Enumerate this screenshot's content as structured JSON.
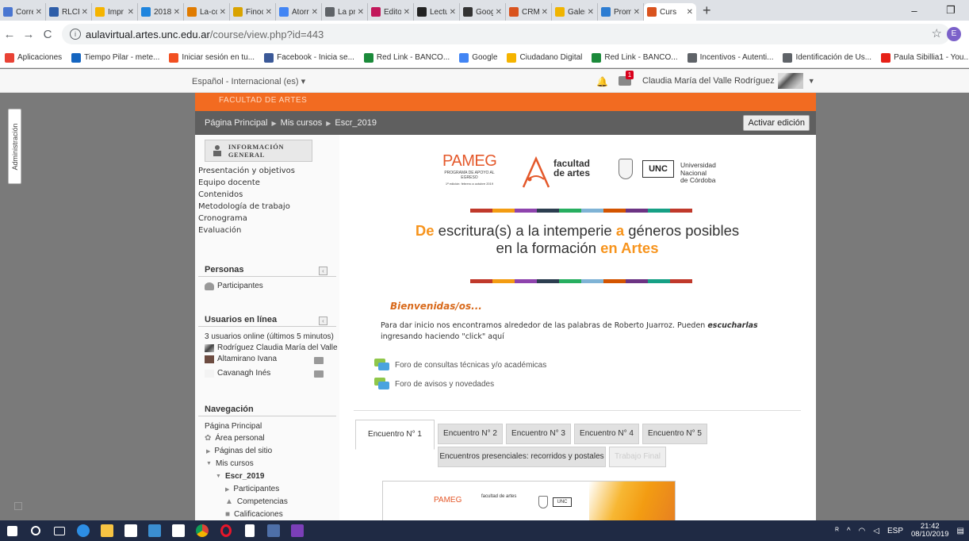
{
  "browser": {
    "tabs": [
      {
        "label": "Corre",
        "color": "#4a76d1"
      },
      {
        "label": "RLCP",
        "color": "#2d5da8"
      },
      {
        "label": "Impr",
        "color": "#f5b400"
      },
      {
        "label": "2018",
        "color": "#1f85de"
      },
      {
        "label": "La-cc",
        "color": "#e07b00"
      },
      {
        "label": "Finoc",
        "color": "#d9a300"
      },
      {
        "label": "Atorr",
        "color": "#4285f4"
      },
      {
        "label": "La pr",
        "color": "#5f6368"
      },
      {
        "label": "Edito",
        "color": "#c2185b"
      },
      {
        "label": "Lectu",
        "color": "#222222"
      },
      {
        "label": "Goog",
        "color": "#333333"
      },
      {
        "label": "CRM",
        "color": "#d9531e"
      },
      {
        "label": "Galer",
        "color": "#f0b400"
      },
      {
        "label": "Prom",
        "color": "#2d7dd2"
      },
      {
        "label": "Curs",
        "color": "#d9531e",
        "active": true
      }
    ],
    "url_host": "aulavirtual.artes.unc.edu.ar",
    "url_path": "/course/view.php?id=443",
    "profile_initial": "E",
    "bookmarks": [
      {
        "label": "Aplicaciones",
        "color": "#e94235"
      },
      {
        "label": "Tiempo Pilar - mete...",
        "color": "#1565c0"
      },
      {
        "label": "Iniciar sesión en tu...",
        "color": "#f25022"
      },
      {
        "label": "Facebook - Inicia se...",
        "color": "#3b5998"
      },
      {
        "label": "Red Link - BANCO...",
        "color": "#1b8a3a"
      },
      {
        "label": "Google",
        "color": "#4285f4"
      },
      {
        "label": "Ciudadano Digital",
        "color": "#f5b400"
      },
      {
        "label": "Red Link - BANCO...",
        "color": "#1b8a3a"
      },
      {
        "label": "Incentivos - Autenti...",
        "color": "#5f6368"
      },
      {
        "label": "Identificación de Us...",
        "color": "#5f6368"
      },
      {
        "label": "Paula Sibillia1 - You...",
        "color": "#e62117"
      }
    ]
  },
  "moodle": {
    "language": "Español - Internacional (es) ▾",
    "notif_count": "1",
    "user_name": "Claudia María del Valle Rodríguez",
    "admin_label": "Administración",
    "faculty_band": "FACULTAD DE ARTES",
    "breadcrumb": [
      "Página Principal",
      "Mis cursos",
      "Escr_2019"
    ],
    "edit_button": "Activar edición"
  },
  "left": {
    "general_info": "INFORMACIÓN GENERAL",
    "general_links": [
      "Presentación y objetivos",
      "Equipo docente",
      "Contenidos",
      "Metodología de trabajo",
      "Cronograma",
      "Evaluación"
    ],
    "people_title": "Personas",
    "participants": "Participantes",
    "online_title": "Usuarios en línea",
    "online_summary": "3 usuarios online (últimos 5 minutos)",
    "online_users": [
      "Rodríguez Claudia María del Valle",
      "Altamirano Ivana",
      "Cavanagh Inés"
    ],
    "nav_title": "Navegación",
    "nav_items": [
      "Página Principal",
      "Área personal",
      "Páginas del sitio",
      "Mis cursos",
      "Escr_2019",
      "Participantes",
      "Competencias",
      "Calificaciones"
    ]
  },
  "main": {
    "pameg_big": "PAMEG",
    "pameg_small": "PROGRAMA DE APOYO AL EGRESO",
    "pameg_tiny": "1ª edición: febrero a octubre 2019",
    "faculty_logo_line1": "facultad",
    "faculty_logo_line2": "de artes",
    "unc_box": "UNC",
    "unc_line1": "Universidad",
    "unc_line2": "Nacional",
    "unc_line3": "de Córdoba",
    "stripe_colors": [
      "#c0392b",
      "#f39c12",
      "#8e44ad",
      "#2c3e50",
      "#27ae60",
      "#7fb3d5",
      "#d35400",
      "#6c3483",
      "#16a085",
      "#c0392b"
    ],
    "headline": {
      "w1": "De",
      "w2": "escritura(s) a la intemperie",
      "w3": "a",
      "w4": "géneros posibles",
      "w5": "en la formación",
      "w6": "en Artes"
    },
    "welcome": "Bienvenidas/os...",
    "intro_1": "Para dar inicio nos encontramos alrededor de las palabras de Roberto Juarroz. Pueden",
    "intro_em": "escucharlas",
    "intro_2": "ingresando haciendo \"click\" aquí",
    "forum_1": "Foro de consultas técnicas y/o académicas",
    "forum_2": "Foro de avisos y novedades",
    "tabs_row1": [
      "Encuentro N° 1",
      "Encuentro N° 2",
      "Encuentro N° 3",
      "Encuentro N° 4",
      "Encuentro N° 5"
    ],
    "tabs_row2": [
      "Encuentros presenciales: recorridos y postales",
      "Trabajo Final"
    ],
    "banner_pameg": "PAMEG",
    "banner_fa": "facultad de artes",
    "banner_unc": "UNC"
  },
  "taskbar": {
    "lang": "ESP",
    "time": "21:42",
    "date": "08/10/2019"
  }
}
